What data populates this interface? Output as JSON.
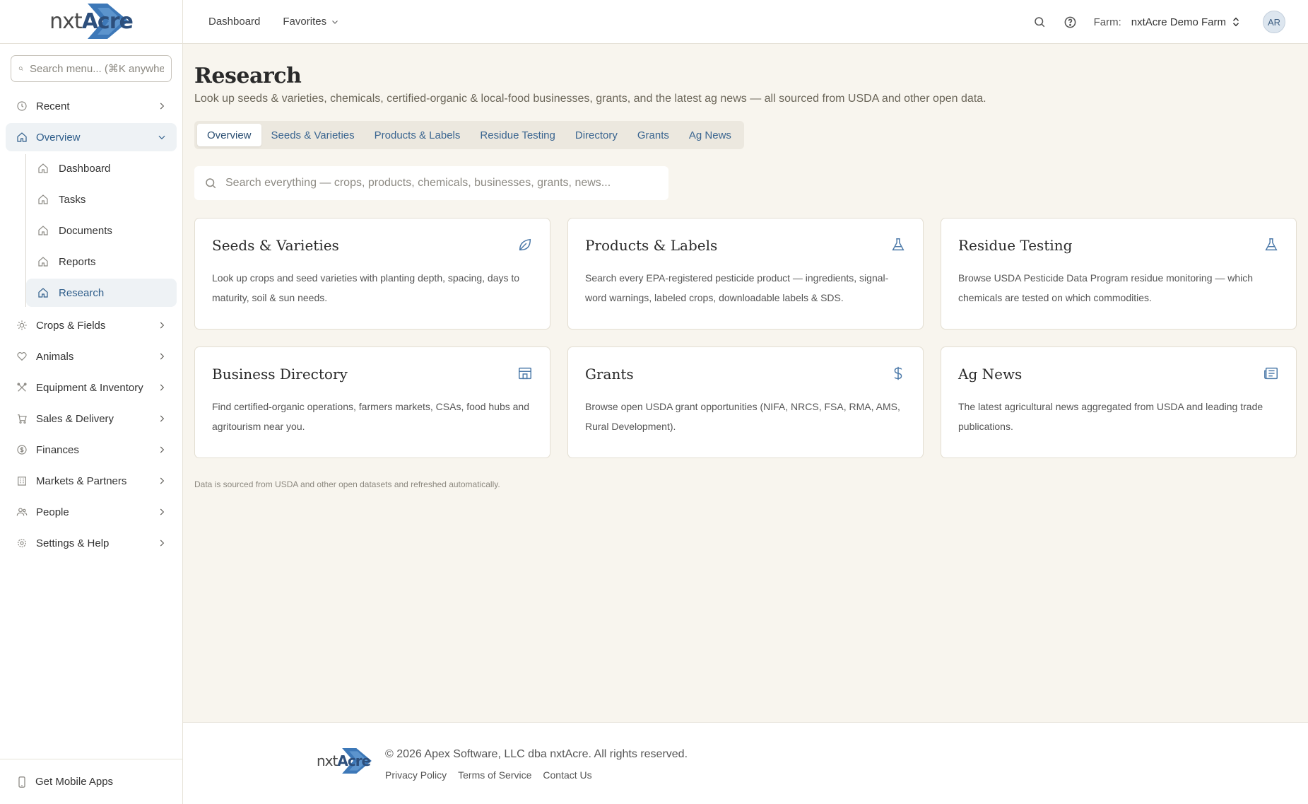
{
  "brand": {
    "logo_pre": "nxt",
    "logo_post": "Acre"
  },
  "sidebar": {
    "search_placeholder": "Search menu... (⌘K anywhere)",
    "recent": "Recent",
    "overview": "Overview",
    "sub_items": [
      "Dashboard",
      "Tasks",
      "Documents",
      "Reports",
      "Research"
    ],
    "sections": [
      "Crops & Fields",
      "Animals",
      "Equipment & Inventory",
      "Sales & Delivery",
      "Finances",
      "Markets & Partners",
      "People",
      "Settings & Help"
    ],
    "mobile": "Get Mobile Apps"
  },
  "header": {
    "dashboard": "Dashboard",
    "favorites": "Favorites",
    "farm_label": "Farm:",
    "farm_name": "nxtAcre Demo Farm",
    "avatar": "AR"
  },
  "main": {
    "title": "Research",
    "subtitle": "Look up seeds & varieties, chemicals, certified-organic & local-food businesses, grants, and the latest ag news — all sourced from USDA and other open data.",
    "tabs": [
      "Overview",
      "Seeds & Varieties",
      "Products & Labels",
      "Residue Testing",
      "Directory",
      "Grants",
      "Ag News"
    ],
    "search_placeholder": "Search everything — crops, products, chemicals, businesses, grants, news...",
    "cards": [
      {
        "title": "Seeds & Varieties",
        "desc": "Look up crops and seed varieties with planting depth, spacing, days to maturity, soil & sun needs.",
        "icon": "leaf-icon"
      },
      {
        "title": "Products & Labels",
        "desc": "Search every EPA-registered pesticide product — ingredients, signal-word warnings, labeled crops, downloadable labels & SDS.",
        "icon": "flask-icon"
      },
      {
        "title": "Residue Testing",
        "desc": "Browse USDA Pesticide Data Program residue monitoring — which chemicals are tested on which commodities.",
        "icon": "flask-icon"
      },
      {
        "title": "Business Directory",
        "desc": "Find certified-organic operations, farmers markets, CSAs, food hubs and agritourism near you.",
        "icon": "store-icon"
      },
      {
        "title": "Grants",
        "desc": "Browse open USDA grant opportunities (NIFA, NRCS, FSA, RMA, AMS, Rural Development).",
        "icon": "dollar-icon"
      },
      {
        "title": "Ag News",
        "desc": "The latest agricultural news aggregated from USDA and leading trade publications.",
        "icon": "newspaper-icon"
      }
    ],
    "note": "Data is sourced from USDA and other open datasets and refreshed automatically."
  },
  "footer": {
    "copyright": "© 2026 Apex Software, LLC dba nxtAcre. All rights reserved.",
    "links": [
      "Privacy Policy",
      "Terms of Service",
      "Contact Us"
    ]
  },
  "colors": {
    "accent": "#2e5d8a",
    "link": "#3a6590",
    "background": "#f8f5ee"
  }
}
